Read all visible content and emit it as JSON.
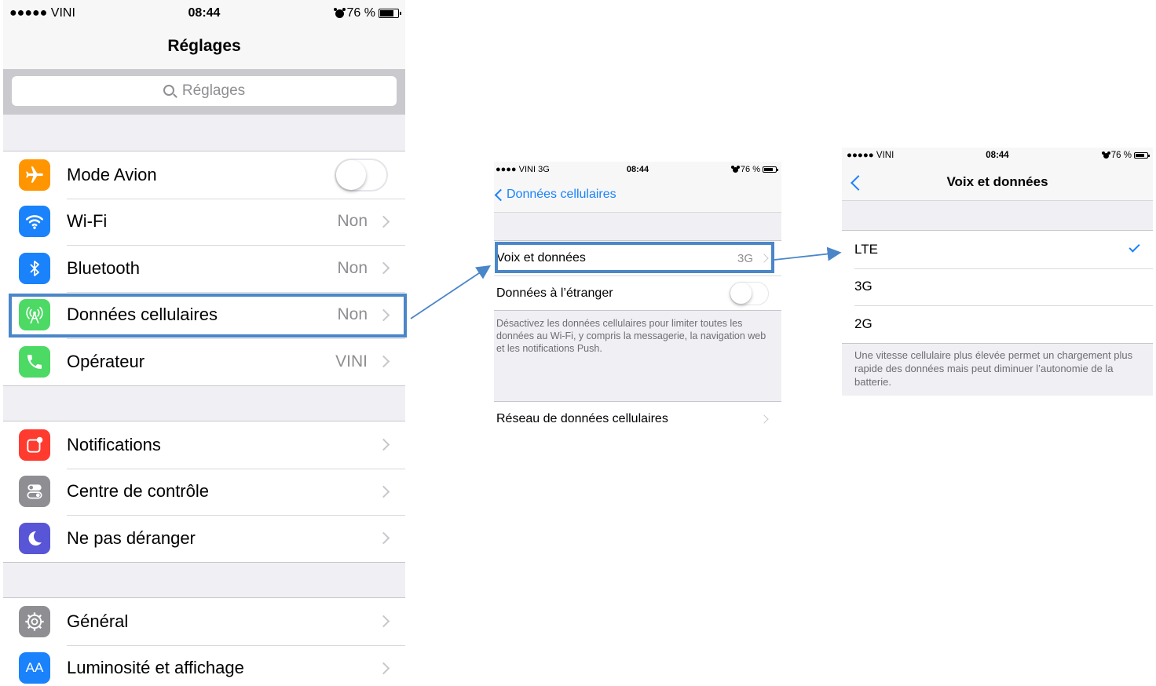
{
  "screen1": {
    "status": {
      "carrier": "●●●●● VINI",
      "time": "08:44",
      "battery": "76 %"
    },
    "title": "Réglages",
    "search": {
      "placeholder": "Réglages"
    },
    "group1": [
      {
        "label": "Mode Avion",
        "value": "",
        "icon": "airplane-icon",
        "color": "#ff9500"
      },
      {
        "label": "Wi-Fi",
        "value": "Non",
        "icon": "wifi-icon",
        "color": "#1a82fb"
      },
      {
        "label": "Bluetooth",
        "value": "Non",
        "icon": "bluetooth-icon",
        "color": "#1a82fb"
      },
      {
        "label": "Données cellulaires",
        "value": "Non",
        "icon": "antenna-icon",
        "color": "#4cd964"
      },
      {
        "label": "Opérateur",
        "value": "VINI",
        "icon": "phone-icon",
        "color": "#4cd964"
      }
    ],
    "group2": [
      {
        "label": "Notifications",
        "icon": "notifications-icon",
        "color": "#ff3b30"
      },
      {
        "label": "Centre de contrôle",
        "icon": "control-center-icon",
        "color": "#8e8e93"
      },
      {
        "label": "Ne pas déranger",
        "icon": "moon-icon",
        "color": "#5856d6"
      }
    ],
    "group3": [
      {
        "label": "Général",
        "icon": "gear-icon",
        "color": "#8e8e93"
      },
      {
        "label": "Luminosité et affichage",
        "icon": "display-icon",
        "color": "#1a82fb"
      }
    ]
  },
  "screen2": {
    "status": {
      "carrier": "●●●● VINI  3G",
      "time": "08:44",
      "battery": "76 %"
    },
    "back": "Données cellulaires",
    "voix": {
      "label": "Voix et données",
      "value": "3G"
    },
    "etranger": {
      "label": "Données à l’étranger"
    },
    "footer": "Désactivez les données cellulaires pour limiter toutes les données au Wi-Fi, y compris la messagerie, la navigation web et les notifications Push.",
    "reseau": {
      "label": "Réseau de données cellulaires"
    }
  },
  "screen3": {
    "status": {
      "carrier": "●●●●● VINI",
      "time": "08:44",
      "battery": "76 %"
    },
    "title": "Voix et données",
    "options": [
      "LTE",
      "3G",
      "2G"
    ],
    "selected": "LTE",
    "footer": "Une vitesse cellulaire plus élevée permet un chargement plus rapide des données mais peut diminuer l’autonomie de la batterie."
  },
  "colors": {
    "accent": "#1a82fb",
    "highlight": "#4a86c8"
  }
}
